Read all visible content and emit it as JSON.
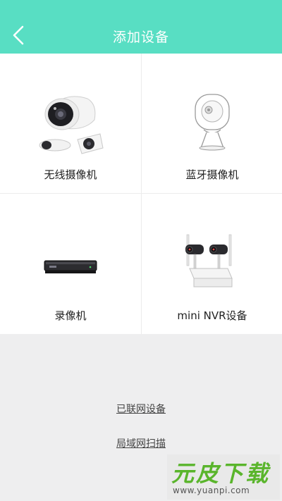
{
  "header": {
    "title": "添加设备",
    "back_icon": "chevron-left-icon",
    "background": "#58dec3"
  },
  "devices": [
    {
      "label": "无线摄像机",
      "icon": "wireless-camera-icon"
    },
    {
      "label": "蓝牙摄像机",
      "icon": "bluetooth-camera-icon"
    },
    {
      "label": "录像机",
      "icon": "recorder-icon"
    },
    {
      "label": "mini NVR设备",
      "icon": "mini-nvr-icon"
    }
  ],
  "links": {
    "connected": "已联网设备",
    "lan_scan": "局域网扫描"
  },
  "watermark": {
    "text": "元皮下载",
    "url": "www.yuanpi.com"
  }
}
